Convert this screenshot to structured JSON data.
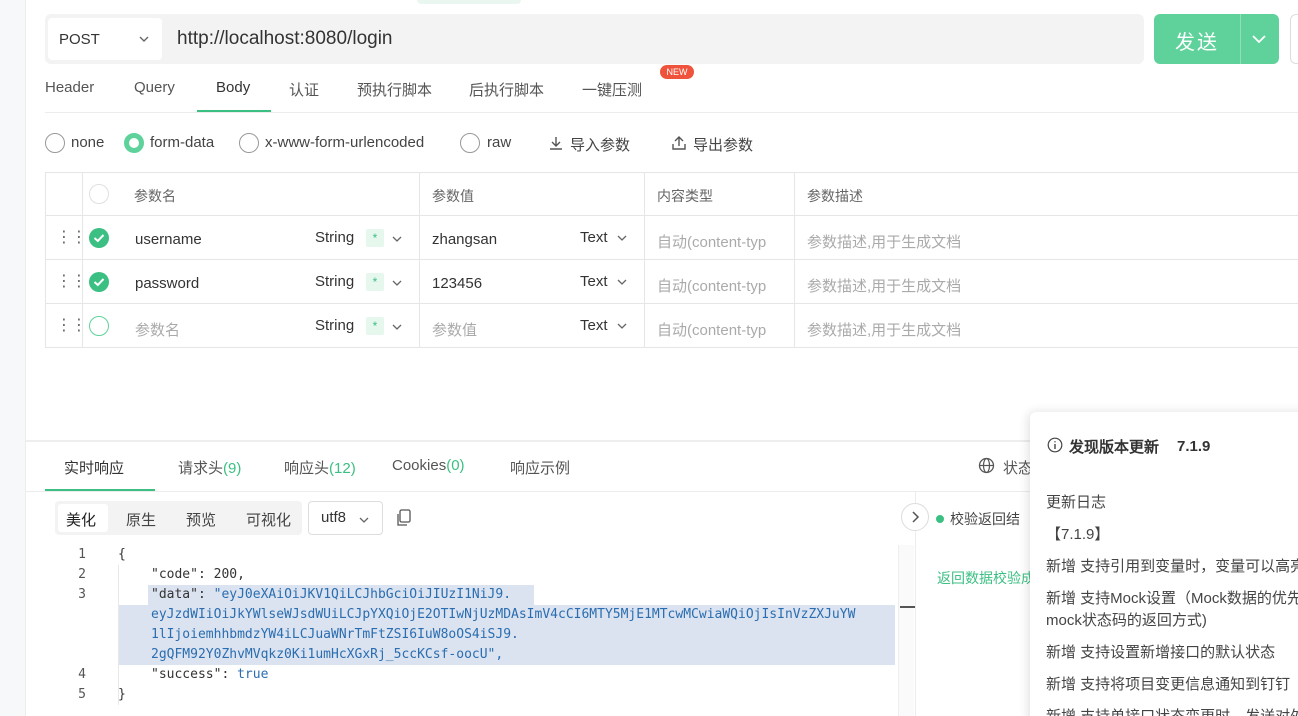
{
  "request": {
    "method": "POST",
    "url": "http://localhost:8080/login",
    "send_label": "发送"
  },
  "tabs": [
    {
      "label": "Header"
    },
    {
      "label": "Query"
    },
    {
      "label": "Body"
    },
    {
      "label": "认证"
    },
    {
      "label": "预执行脚本"
    },
    {
      "label": "后执行脚本"
    },
    {
      "label": "一键压测"
    }
  ],
  "new_badge": "NEW",
  "body_modes": {
    "none": "none",
    "form_data": "form-data",
    "urlencoded": "x-www-form-urlencoded",
    "raw": "raw",
    "selected": "form-data"
  },
  "actions": {
    "import": "导入参数",
    "export": "导出参数"
  },
  "table": {
    "headers": {
      "name": "参数名",
      "value": "参数值",
      "content_type": "内容类型",
      "description": "参数描述"
    },
    "rows": [
      {
        "checked": true,
        "name": "username",
        "type": "String",
        "required": "*",
        "value": "zhangsan",
        "value_type": "Text",
        "content_type": "自动(content-typ",
        "description": "参数描述,用于生成文档"
      },
      {
        "checked": true,
        "name": "password",
        "type": "String",
        "required": "*",
        "value": "123456",
        "value_type": "Text",
        "content_type": "自动(content-typ",
        "description": "参数描述,用于生成文档"
      },
      {
        "checked": false,
        "name": "参数名",
        "type": "String",
        "required": "*",
        "value": "参数值",
        "value_type": "Text",
        "content_type": "自动(content-typ",
        "description": "参数描述,用于生成文档"
      }
    ]
  },
  "response": {
    "tabs": {
      "realtime": "实时响应",
      "req_headers": "请求头",
      "req_headers_count": "(9)",
      "resp_headers": "响应头",
      "resp_headers_count": "(12)",
      "cookies": "Cookies",
      "cookies_count": "(0)",
      "example": "响应示例"
    },
    "status_label": "状态",
    "views": {
      "pretty": "美化",
      "raw": "原生",
      "preview": "预览",
      "visual": "可视化"
    },
    "encoding": "utf8",
    "code_lines": {
      "l1": "{",
      "l2_key": "\"code\"",
      "l2_val": "200,",
      "l3_key": "\"data\"",
      "l3_val": "\"eyJ0eXAiOiJKV1QiLCJhbGciOiJIUzI1NiJ9.",
      "l3_w1": "eyJzdWIiOiJkYWlseWJsdWUiLCJpYXQiOjE2OTIwNjUzMDAsImV4cCI6MTY5MjE1MTcwMCwiaWQiOjIsInVzZXJuYW",
      "l3_w2": "1lIjoiemhhbmdzYW4iLCJuaWNrTmFtZSI6IuW8oOS4iSJ9.",
      "l3_w3": "2gQFM92Y0ZhvMVqkz0Ki1umHcXGxRj_5ccKCsf-oocU\",",
      "l4_key": "\"success\"",
      "l4_val": "true",
      "l5": "}"
    },
    "line_numbers": [
      "1",
      "2",
      "3",
      "4",
      "5"
    ],
    "validate_label": "校验返回结",
    "validate_result": "返回数据校验成"
  },
  "update_popup": {
    "title": "发现版本更新",
    "version": "7.1.9",
    "changelog_label": "更新日志",
    "version_tag": "【7.1.9】",
    "items": [
      "新增 支持引用到变量时，变量可以高亮",
      "新增 支持Mock设置（Mock数据的优先",
      "mock状态码的返回方式)",
      "新增 支持设置新增接口的默认状态",
      "新增 支持将项目变更信息通知到钉钉",
      "新增 支持单接口状态变更时，发送对外"
    ]
  },
  "colors": {
    "accent": "#5fd29b",
    "accent_dark": "#3bbf82",
    "badge": "#f0533c"
  }
}
